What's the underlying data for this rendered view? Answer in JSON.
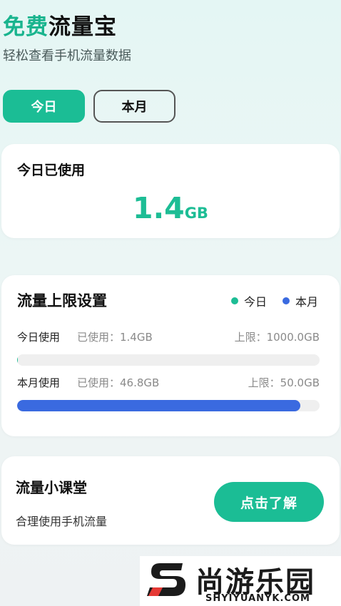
{
  "header": {
    "title_accent": "免费",
    "title_rest": "流量宝",
    "subtitle": "轻松查看手机流量数据"
  },
  "tabs": [
    {
      "label": "今日",
      "active": true
    },
    {
      "label": "本月",
      "active": false
    }
  ],
  "usage_card": {
    "title": "今日已使用",
    "value": "1.4",
    "unit": "GB"
  },
  "limit_card": {
    "title": "流量上限设置",
    "legend": [
      {
        "label": "今日",
        "color": "#1dbd95"
      },
      {
        "label": "本月",
        "color": "#3a6ae0"
      }
    ],
    "rows": [
      {
        "label": "今日使用",
        "used": "已使用：1.4GB",
        "limit": "上限：1000.0GB",
        "progress": 0.0014,
        "color": "#1dbd95"
      },
      {
        "label": "本月使用",
        "used": "已使用：46.8GB",
        "limit": "上限：50.0GB",
        "progress": 0.936,
        "color": "#3a6ae0"
      }
    ]
  },
  "course_card": {
    "title": "流量小课堂",
    "subtitle": "合理使用手机流量",
    "button": "点击了解"
  },
  "watermark": {
    "cn": "尚游乐园",
    "en": "SHYIYUANYK.COM"
  },
  "colors": {
    "accent": "#1bbd95",
    "blue": "#3a6ae0"
  }
}
